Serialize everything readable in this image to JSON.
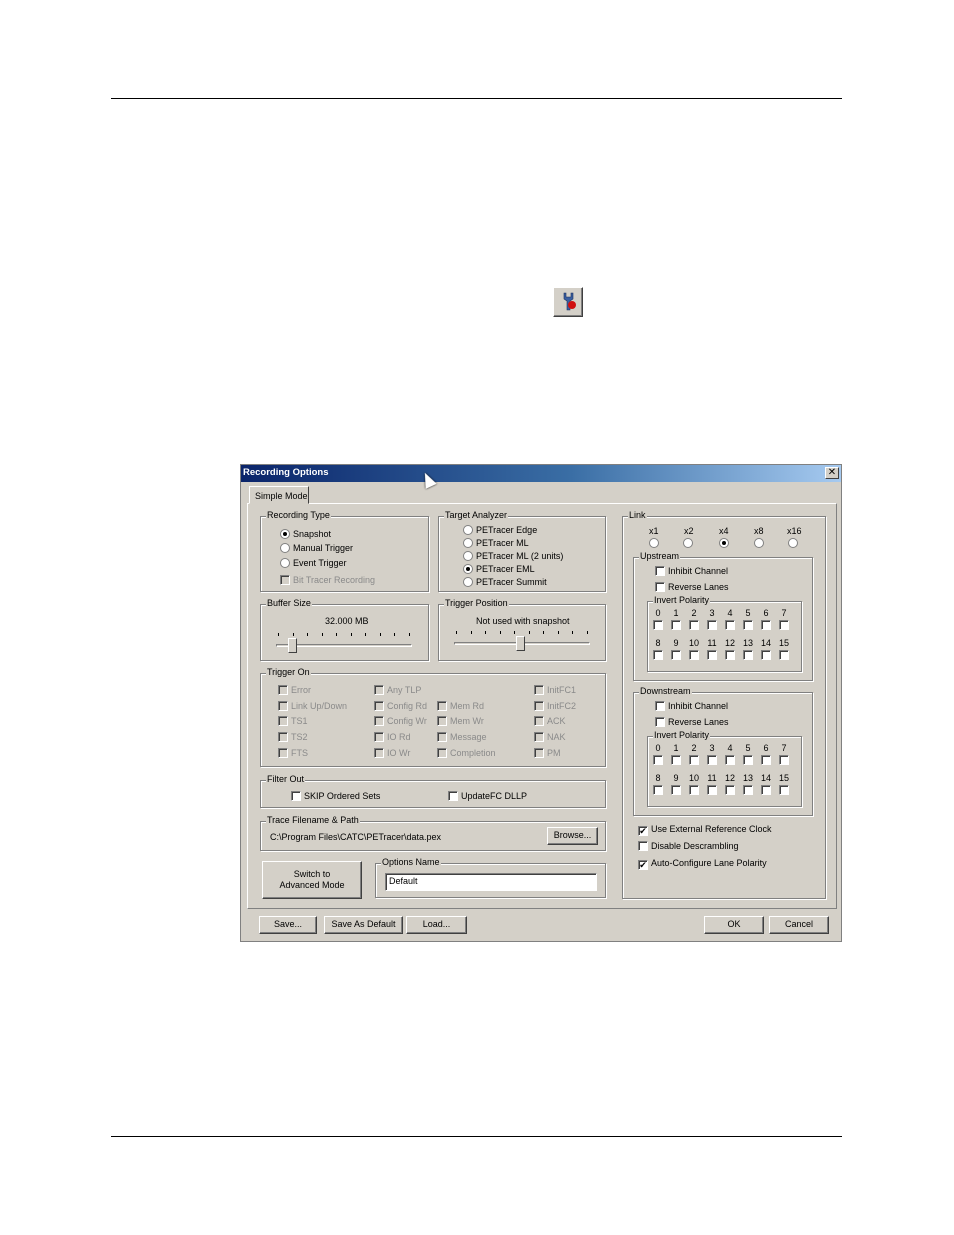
{
  "dialog": {
    "title": "Recording Options",
    "tab": "Simple Mode",
    "recording_type": {
      "label": "Recording Type",
      "options": [
        "Snapshot",
        "Manual Trigger",
        "Event Trigger"
      ],
      "selected": "Snapshot",
      "bit_tracer": "Bit Tracer Recording"
    },
    "target_analyzer": {
      "label": "Target Analyzer",
      "options": [
        "PETracer Edge",
        "PETracer ML",
        "PETracer ML (2 units)",
        "PETracer EML",
        "PETracer Summit"
      ],
      "selected": "PETracer EML"
    },
    "buffer_size": {
      "label": "Buffer Size",
      "value": "32.000 MB",
      "level": 0.12
    },
    "trigger_position": {
      "label": "Trigger Position",
      "note": "Not used with snapshot",
      "level": 0.5
    },
    "trigger_on": {
      "label": "Trigger On",
      "col1": [
        "Error",
        "Link Up/Down",
        "TS1",
        "TS2",
        "FTS"
      ],
      "col2": [
        "Any TLP",
        "Config Rd",
        "Config Wr",
        "IO Rd",
        "IO Wr"
      ],
      "col3": [
        "Mem Rd",
        "Mem Wr",
        "Message",
        "Completion"
      ],
      "col4": [
        "InitFC1",
        "InitFC2",
        "ACK",
        "NAK",
        "PM"
      ]
    },
    "filter_out": {
      "label": "Filter Out",
      "skip": "SKIP Ordered Sets",
      "updatefc": "UpdateFC DLLP"
    },
    "trace_file": {
      "label": "Trace Filename & Path",
      "path": "C:\\Program Files\\CATC\\PETracer\\data.pex",
      "browse": "Browse..."
    },
    "switch_mode": {
      "line1": "Switch to",
      "line2": "Advanced Mode"
    },
    "options_name": {
      "label": "Options Name",
      "value": "Default"
    },
    "link": {
      "label": "Link",
      "widths": [
        "x1",
        "x2",
        "x4",
        "x8",
        "x16"
      ],
      "selected": "x4"
    },
    "upstream": {
      "label": "Upstream",
      "inhibit": "Inhibit Channel",
      "reverse": "Reverse Lanes",
      "polarity": "Invert Polarity"
    },
    "downstream": {
      "label": "Downstream",
      "inhibit": "Inhibit Channel",
      "reverse": "Reverse Lanes",
      "polarity": "Invert Polarity"
    },
    "lanes_row1": [
      "0",
      "1",
      "2",
      "3",
      "4",
      "5",
      "6",
      "7"
    ],
    "lanes_row2": [
      "8",
      "9",
      "10",
      "11",
      "12",
      "13",
      "14",
      "15"
    ],
    "ext_clock": "Use External Reference Clock",
    "disable_descrambling": "Disable Descrambling",
    "auto_configure": "Auto-Configure Lane Polarity",
    "buttons": {
      "save": "Save...",
      "save_default": "Save As Default",
      "load": "Load...",
      "ok": "OK",
      "cancel": "Cancel"
    }
  },
  "icons": {
    "toolbar": "recording-options-icon",
    "close": "close-icon"
  }
}
